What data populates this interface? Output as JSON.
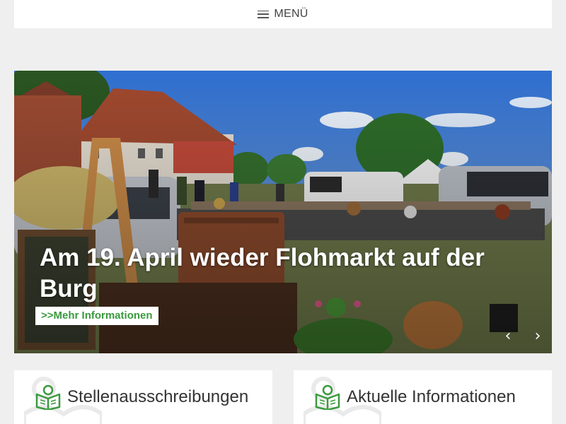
{
  "header": {
    "menu_label": "MENÜ"
  },
  "slider": {
    "title": "Am 19. April wieder Flohmarkt auf der Burg",
    "more_link": ">>Mehr Informationen",
    "prev_arrow": "‹",
    "next_arrow": "›"
  },
  "cards": [
    {
      "title": "Stellenausschreibungen",
      "icon": "reading-person-icon"
    },
    {
      "title": "Aktuelle Informationen",
      "icon": "reading-person-icon"
    }
  ],
  "colors": {
    "accent_green": "#3a9a3e",
    "page_bg": "#efefef"
  }
}
